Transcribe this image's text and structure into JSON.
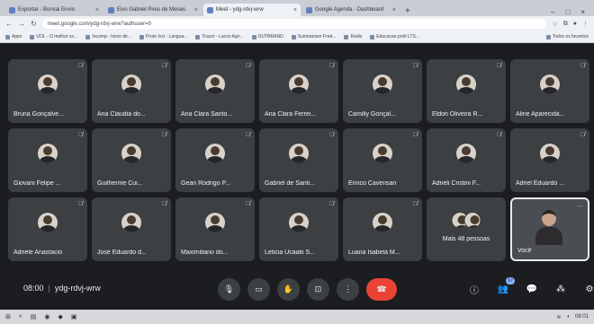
{
  "browser": {
    "tabs": [
      {
        "label": "Exportar - Bonsai Envio",
        "active": false
      },
      {
        "label": "Eixo Gabriel Pires de Morais",
        "active": false
      },
      {
        "label": "Meet - ydg-rdvj-wrw",
        "active": true
      },
      {
        "label": "Google Agenda - Dashboard",
        "active": false
      }
    ],
    "new_tab": "+",
    "url": "meet.google.com/ydg-rdvj-wrw?authuser=0",
    "bookmarks": [
      "Apps",
      "UOL - O melhor co...",
      "Incomp - Inicio de...",
      "Proto Incl - Langua...",
      "Tracer - Lacos Agri...",
      "OUTBRAND",
      "Summarizer Fred...",
      "Redis",
      "Educacao profi LTS...",
      "Todos os favoritos"
    ]
  },
  "participants": [
    {
      "name": "Bruna Gonçalve..."
    },
    {
      "name": "Ana Claudia do..."
    },
    {
      "name": "Ana Clara Santo..."
    },
    {
      "name": "Ana Clara Ferrei..."
    },
    {
      "name": "Camilly Gonçal..."
    },
    {
      "name": "Eldon Oliveira R..."
    },
    {
      "name": "Aline Aparecida..."
    },
    {
      "name": "Giovani Felipe ..."
    },
    {
      "name": "Guilherme Cui..."
    },
    {
      "name": "Gean Rodrigo P..."
    },
    {
      "name": "Gabriel de Santi..."
    },
    {
      "name": "Enrico Cavensan"
    },
    {
      "name": "Adrieli Cristini F..."
    },
    {
      "name": "Adriel Eduardo ..."
    },
    {
      "name": "Adriele Anastacio"
    },
    {
      "name": "José Eduardo d..."
    },
    {
      "name": "Maximiliano do..."
    },
    {
      "name": "Leticia Ucaaki S..."
    },
    {
      "name": "Luana Isabela M..."
    }
  ],
  "more_tile": {
    "label": "Mais 48 pessoas"
  },
  "self_tile": {
    "label": "Você"
  },
  "meeting": {
    "time": "08:00",
    "separator": "|",
    "code": "ydg-rdvj-wrw"
  },
  "controls": {
    "mic": "🎙",
    "camera": "▭",
    "hand": "✋",
    "present": "⊡",
    "more": "⋮",
    "end": "☎"
  },
  "right_panel": {
    "info": "ⓘ",
    "people": "👥",
    "people_count": "67",
    "chat": "💬",
    "activities": "⁂",
    "host": "⚙"
  },
  "taskbar": {
    "start": "⊞",
    "search": "⌕",
    "time": "08:01"
  }
}
